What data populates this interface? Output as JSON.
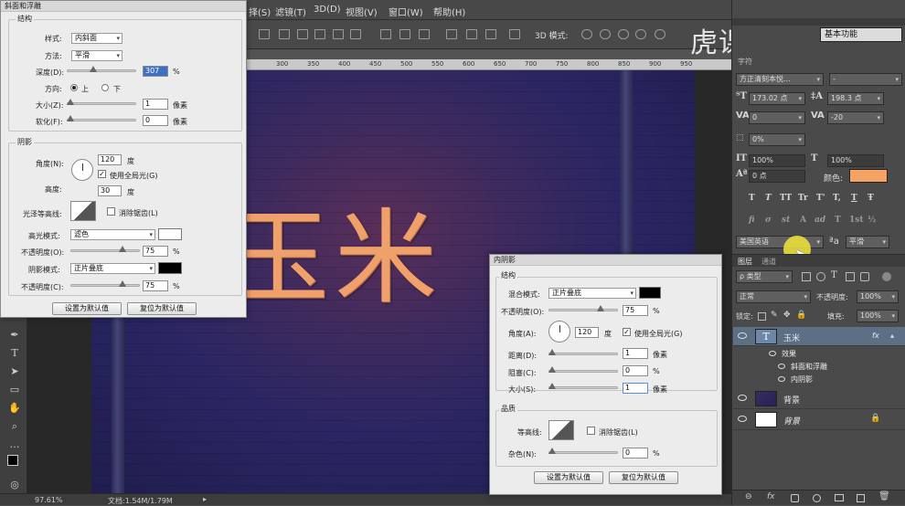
{
  "menubar": {
    "items": [
      "择(S)",
      "滤镜(T)",
      "3D(D)",
      "视图(V)",
      "窗口(W)",
      "帮助(H)"
    ]
  },
  "optbar": {
    "mode3d": "3D 模式:",
    "workspace": "基本功能"
  },
  "watermark": "虎课网",
  "ruler": {
    "ticks": [
      "300",
      "350",
      "400",
      "450",
      "500",
      "550",
      "600",
      "650",
      "700",
      "750",
      "800",
      "850",
      "900",
      "950"
    ]
  },
  "canvas": {
    "text": "玉米"
  },
  "status": {
    "zoom": "97.61%",
    "doc": "文档:1.54M/1.79M"
  },
  "bevel": {
    "title": "斜面和浮雕",
    "structure": "结构",
    "style_label": "样式:",
    "style": "内斜面",
    "technique_label": "方法:",
    "technique": "平滑",
    "depth_label": "深度(D):",
    "depth": "307",
    "pct": "%",
    "direction_label": "方向:",
    "up": "上",
    "down": "下",
    "size_label": "大小(Z):",
    "size": "1",
    "px": "像素",
    "soften_label": "软化(F):",
    "soften": "0",
    "shading": "阴影",
    "angle_label": "角度(N):",
    "angle": "120",
    "deg": "度",
    "global_light": "使用全局光(G)",
    "altitude_label": "高度:",
    "altitude": "30",
    "gloss_label": "光泽等高线:",
    "antialias": "消除锯齿(L)",
    "hl_mode_label": "高光模式:",
    "hl_mode": "滤色",
    "hl_opacity_label": "不透明度(O):",
    "hl_opacity": "75",
    "sh_mode_label": "阴影模式:",
    "sh_mode": "正片叠底",
    "sh_opacity_label": "不透明度(C):",
    "sh_opacity": "75",
    "btn_default": "设置为默认值",
    "btn_reset": "复位为默认值",
    "colors": {
      "highlight": "#ffffff",
      "shadow": "#000000"
    }
  },
  "inner_shadow": {
    "title": "内阴影",
    "structure": "结构",
    "blend_label": "混合模式:",
    "blend": "正片叠底",
    "opacity_label": "不透明度(O):",
    "opacity": "75",
    "pct": "%",
    "angle_label": "角度(A):",
    "angle": "120",
    "deg": "度",
    "global_light": "使用全局光(G)",
    "distance_label": "距离(D):",
    "distance": "1",
    "px": "像素",
    "choke_label": "阻塞(C):",
    "choke": "0",
    "size_label": "大小(S):",
    "size": "1",
    "quality": "品质",
    "contour_label": "等高线:",
    "antialias": "消除锯齿(L)",
    "noise_label": "杂色(N):",
    "noise": "0",
    "btn_default": "设置为默认值",
    "btn_reset": "复位为默认值",
    "color": "#000000"
  },
  "char_panel": {
    "tab": "字符",
    "font": "方正清刻本悦...",
    "font_style": "-",
    "size": "173.02 点",
    "leading": "198.3 点",
    "kerning": "0",
    "tracking": "-20",
    "scale_label": "0%",
    "v_scale": "100%",
    "h_scale": "100%",
    "baseline": "0 点",
    "color_label": "颜色:",
    "color": "#f7a265",
    "styles": [
      "T",
      "T",
      "TT",
      "Tr",
      "T'",
      "T,",
      "T",
      "Ŧ"
    ],
    "ot": [
      "fi",
      "σ",
      "st",
      "A",
      "ad",
      "T",
      "1st",
      "½"
    ],
    "language": "美国英语",
    "aa_label": "ªa",
    "aa": "平滑"
  },
  "layers_panel": {
    "tabs": [
      "图层",
      "通道"
    ],
    "filter": "ρ 类型",
    "blend": "正常",
    "opacity_label": "不透明度:",
    "opacity": "100%",
    "lock_label": "锁定:",
    "fill_label": "填充:",
    "fill": "100%",
    "layers": [
      {
        "name": "玉米",
        "fx": "fx"
      },
      {
        "name": "效果"
      },
      {
        "name": "斜面和浮雕"
      },
      {
        "name": "内阴影"
      },
      {
        "name": "背景"
      },
      {
        "name": "背景"
      }
    ]
  }
}
